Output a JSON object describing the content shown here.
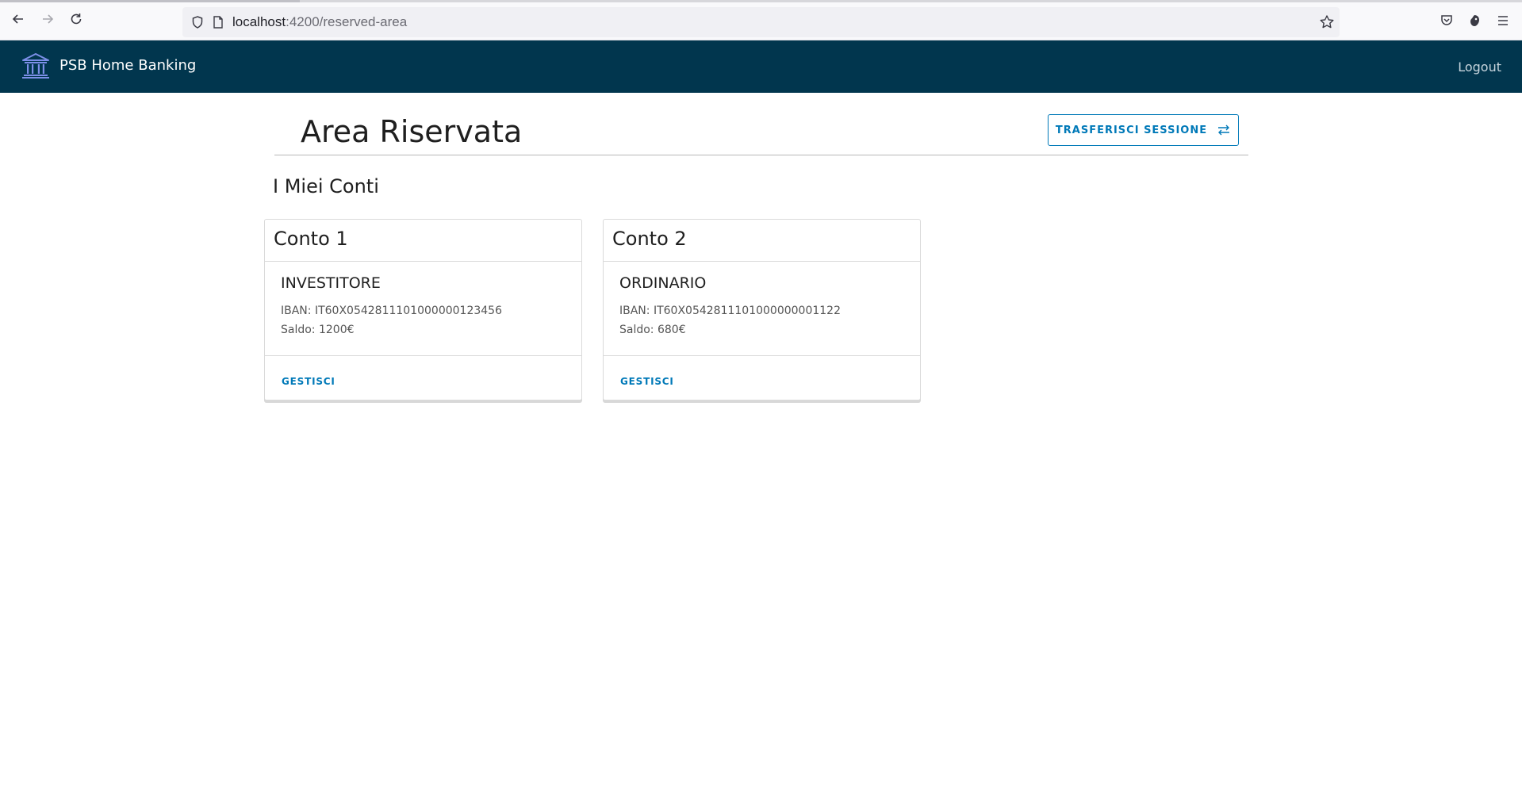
{
  "browser": {
    "url_host": "localhost",
    "url_path": ":4200/reserved-area"
  },
  "header": {
    "brand": "PSB Home Banking",
    "logout": "Logout"
  },
  "main": {
    "title": "Area Riservata",
    "transfer_button": "TRASFERISCI SESSIONE",
    "section_title": "I Miei Conti"
  },
  "accounts": [
    {
      "name": "Conto 1",
      "type": "INVESTITORE",
      "iban": "IBAN: IT60X0542811101000000123456",
      "balance": "Saldo: 1200€",
      "action": "GESTISCI"
    },
    {
      "name": "Conto 2",
      "type": "ORDINARIO",
      "iban": "IBAN: IT60X0542811101000000001122",
      "balance": "Saldo: 680€",
      "action": "GESTISCI"
    }
  ],
  "colors": {
    "header_bg": "#01364e",
    "accent": "#0079b8"
  }
}
